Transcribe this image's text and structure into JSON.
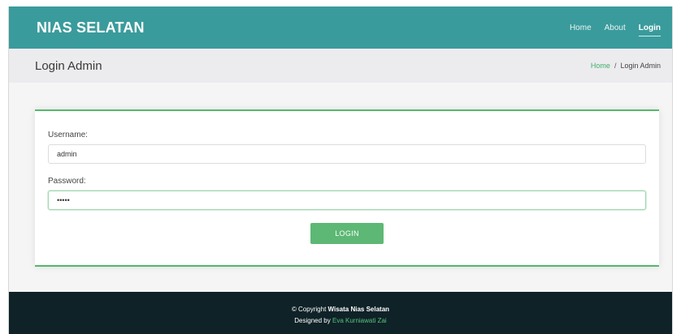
{
  "navbar": {
    "brand": "NIAS SELATAN",
    "links": [
      {
        "label": "Home"
      },
      {
        "label": "About"
      },
      {
        "label": "Login"
      }
    ]
  },
  "breadcrumb_bar": {
    "title": "Login Admin",
    "crumbs": {
      "home": "Home",
      "separator": "/",
      "current": "Login Admin"
    }
  },
  "form": {
    "username_label": "Username:",
    "username_value": "admin",
    "password_label": "Password:",
    "password_value": "•••••",
    "submit_label": "LOGIN"
  },
  "footer": {
    "copyright_prefix": "© Copyright",
    "copyright_name": "Wisata Nias Selatan",
    "designed_prefix": "Designed by",
    "designer": "Eva Kurniawati Zai"
  },
  "colors": {
    "navbar": "#3a9b9c",
    "accent_green": "#57b86a",
    "footer": "#0f2227"
  }
}
